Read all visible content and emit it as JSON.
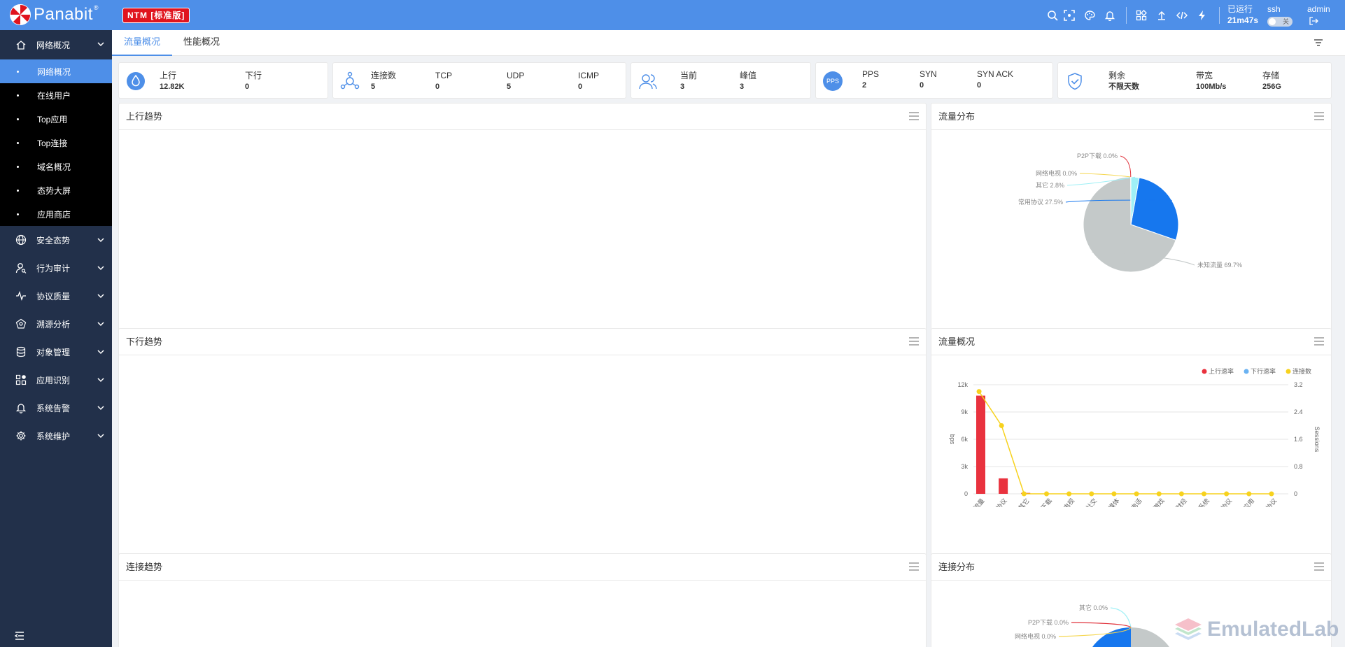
{
  "header": {
    "brand": "Panabit",
    "reg_mark": "®",
    "edition": "NTM [标准版]",
    "uptime_label": "已运行",
    "uptime_value": "21m47s",
    "ssh_label": "ssh",
    "ssh_toggle": "关",
    "user": "admin",
    "icons": [
      "search-icon",
      "fullscreen-icon",
      "palette-icon",
      "bell-icon",
      "apps-icon",
      "upload-icon",
      "code-icon",
      "lightning-icon",
      "logout-icon"
    ]
  },
  "sidebar": {
    "groups": [
      {
        "label": "网络概况",
        "icon": "home-icon",
        "expanded": true,
        "items": [
          "网络概况",
          "在线用户",
          "Top应用",
          "Top连接",
          "域名概况",
          "态势大屏",
          "应用商店"
        ],
        "active": 0
      },
      {
        "label": "安全态势",
        "icon": "globe-icon"
      },
      {
        "label": "行为审计",
        "icon": "user-audit-icon"
      },
      {
        "label": "协议质量",
        "icon": "pulse-icon"
      },
      {
        "label": "溯源分析",
        "icon": "trace-icon"
      },
      {
        "label": "对象管理",
        "icon": "database-icon"
      },
      {
        "label": "应用识别",
        "icon": "app-recognition-icon"
      },
      {
        "label": "系统告警",
        "icon": "bell-icon"
      },
      {
        "label": "系统维护",
        "icon": "gear-icon"
      }
    ]
  },
  "tabs": [
    {
      "label": "流量概况",
      "active": true
    },
    {
      "label": "性能概况",
      "active": false
    }
  ],
  "stats": {
    "traffic": {
      "up_label": "上行",
      "up_value": "12.82K",
      "down_label": "下行",
      "down_value": "0"
    },
    "conn": {
      "conn_label": "连接数",
      "conn_value": "5",
      "tcp_label": "TCP",
      "tcp_value": "0",
      "udp_label": "UDP",
      "udp_value": "5",
      "icmp_label": "ICMP",
      "icmp_value": "0"
    },
    "users": {
      "cur_label": "当前",
      "cur_value": "3",
      "peak_label": "峰值",
      "peak_value": "3"
    },
    "pps": {
      "icon_text": "PPS",
      "pps_label": "PPS",
      "pps_value": "2",
      "syn_label": "SYN",
      "syn_value": "0",
      "synack_label": "SYN ACK",
      "synack_value": "0"
    },
    "license": {
      "remain_label": "剩余",
      "remain_value": "不限天数",
      "bw_label": "带宽",
      "bw_value": "100Mb/s",
      "storage_label": "存储",
      "storage_value": "256G"
    }
  },
  "panels": {
    "up_trend": "上行趋势",
    "flow_dist": "流量分布",
    "down_trend": "下行趋势",
    "flow_overview": "流量概况",
    "conn_trend": "连接趋势",
    "conn_dist": "连接分布"
  },
  "chart_data": [
    {
      "type": "pie",
      "title": "流量分布",
      "categories": [
        "未知流量",
        "常用协议",
        "其它",
        "网络电视",
        "P2P下载"
      ],
      "values": [
        69.7,
        27.5,
        2.8,
        0.0,
        0.0
      ],
      "labels": [
        "未知流量 69.7%",
        "常用协议 27.5%",
        "其它 2.8%",
        "网络电视 0.0%",
        "P2P下载 0.0%"
      ],
      "colors": [
        "#c4c9c9",
        "#1677ee",
        "#9ff0f6",
        "#f5d64e",
        "#e0313a"
      ]
    },
    {
      "type": "bar",
      "title": "流量概况",
      "categories": [
        "未知流量",
        "常用协议",
        "其它",
        "P2P下载",
        "网络电视",
        "社交",
        "流媒体",
        "网络电话",
        "网络游戏",
        "金融财经",
        "商业系统",
        "HTTP协议",
        "移动应用",
        "自定义协议"
      ],
      "series": [
        {
          "name": "上行速率",
          "type": "bar",
          "color": "#e9323e",
          "values": [
            10800,
            1700,
            100,
            0,
            0,
            0,
            0,
            0,
            0,
            0,
            0,
            0,
            0,
            0
          ]
        },
        {
          "name": "下行速率",
          "type": "bar",
          "color": "#6ab2f2",
          "values": [
            0,
            0,
            0,
            0,
            0,
            0,
            0,
            0,
            0,
            0,
            0,
            0,
            0,
            0
          ]
        },
        {
          "name": "连接数",
          "type": "line",
          "axis": "right",
          "color": "#f7d21e",
          "values": [
            3,
            2,
            0,
            0,
            0,
            0,
            0,
            0,
            0,
            0,
            0,
            0,
            0,
            0
          ]
        }
      ],
      "ylabel": "bps",
      "y2label": "Sessions",
      "y_ticks": [
        "0",
        "3k",
        "6k",
        "9k",
        "12k"
      ],
      "y2_ticks": [
        "0",
        "0.8",
        "1.6",
        "2.4",
        "3.2"
      ],
      "ylim": [
        0,
        12000
      ],
      "y2lim": [
        0,
        3.2
      ],
      "legend": "top-right"
    },
    {
      "type": "pie",
      "title": "连接分布",
      "categories": [
        "其它",
        "P2P下载",
        "网络电视"
      ],
      "labels": [
        "其它 0.0%",
        "P2P下载 0.0%",
        "网络电视 0.0%"
      ],
      "colors": [
        "#9ff0f6",
        "#e0313a",
        "#f5d64e"
      ]
    }
  ],
  "watermark": "EmulatedLab"
}
